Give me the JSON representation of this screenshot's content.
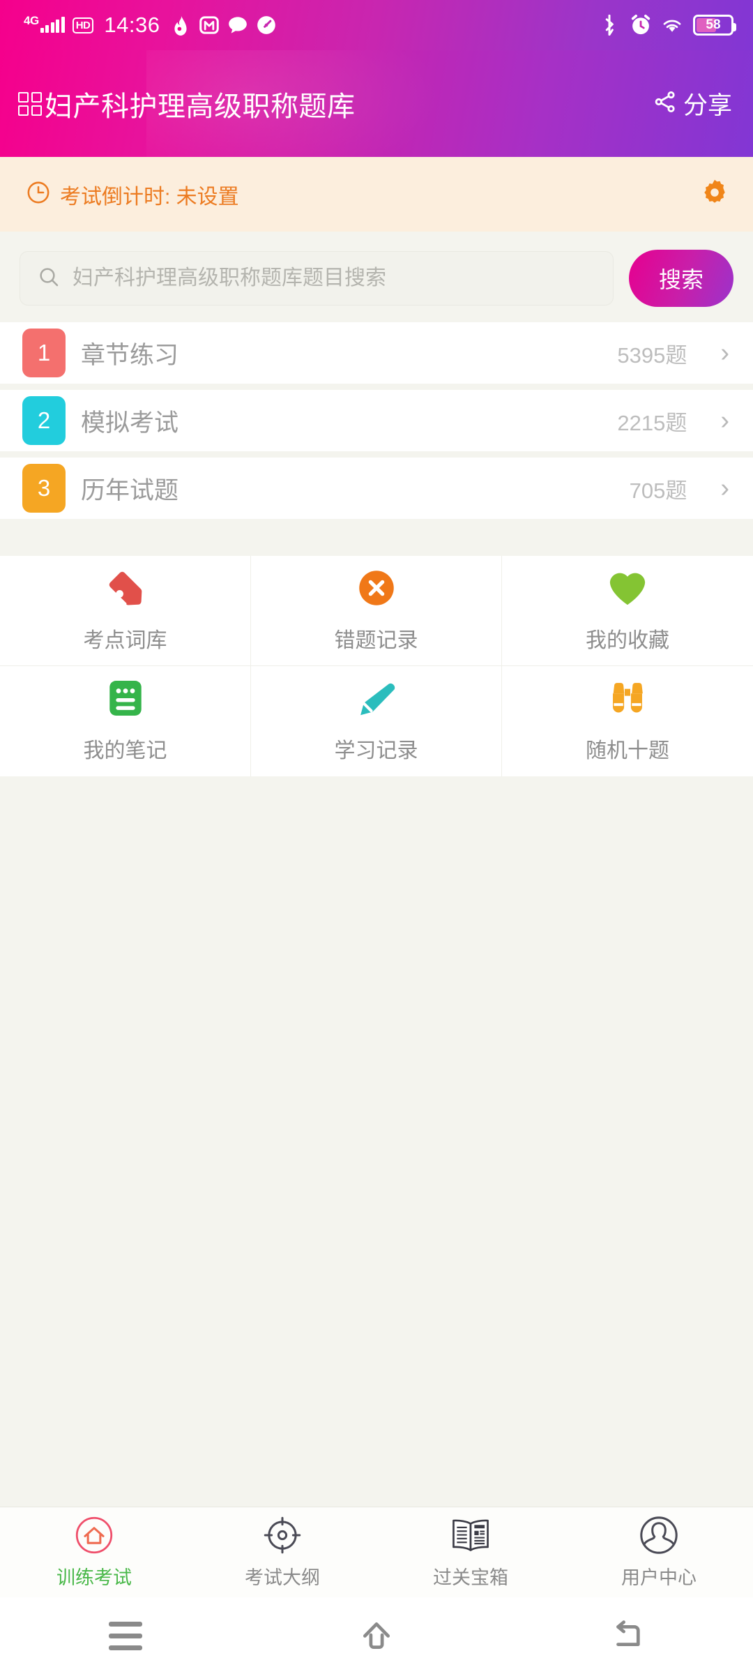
{
  "statusbar": {
    "network_label": "4G",
    "hd_label": "HD",
    "time": "14:36",
    "battery_level": "58",
    "icons": [
      "signal-bars-icon",
      "hd-icon",
      "flame-app-icon",
      "m-app-icon",
      "chat-bubble-icon",
      "speedometer-app-icon",
      "bluetooth-icon",
      "alarm-icon",
      "wifi-icon",
      "battery-icon"
    ]
  },
  "appbar": {
    "title": "妇产科护理高级职称题库",
    "share_label": "分享"
  },
  "countdown": {
    "text": "考试倒计时: 未设置",
    "clock_icon": "clock-icon",
    "settings_icon": "gear-icon",
    "accent_color": "#ec7b21",
    "bg_color": "#fceedd"
  },
  "search": {
    "placeholder": "妇产科护理高级职称题库题目搜索",
    "value": "",
    "button_label": "搜索"
  },
  "rows": [
    {
      "num": "1",
      "label": "章节练习",
      "count": "5395题",
      "color": "#f4706e"
    },
    {
      "num": "2",
      "label": "模拟考试",
      "count": "2215题",
      "color": "#22cddd"
    },
    {
      "num": "3",
      "label": "历年试题",
      "count": "705题",
      "color": "#f5a623"
    }
  ],
  "grid": [
    {
      "label": "考点词库",
      "icon": "tag-icon",
      "color": "#e1504a"
    },
    {
      "label": "错题记录",
      "icon": "close-circle-icon",
      "color": "#f07818"
    },
    {
      "label": "我的收藏",
      "icon": "heart-icon",
      "color": "#84c433"
    },
    {
      "label": "我的笔记",
      "icon": "notes-icon",
      "color": "#35b44a"
    },
    {
      "label": "学习记录",
      "icon": "pencil-icon",
      "color": "#2bbdbd"
    },
    {
      "label": "随机十题",
      "icon": "binoculars-icon",
      "color": "#f5a623"
    }
  ],
  "tabs": [
    {
      "label": "训练考试",
      "icon": "home-circle-icon",
      "active": true
    },
    {
      "label": "考试大纲",
      "icon": "target-icon",
      "active": false
    },
    {
      "label": "过关宝箱",
      "icon": "newspaper-icon",
      "active": false
    },
    {
      "label": "用户中心",
      "icon": "user-circle-icon",
      "active": false
    }
  ],
  "navbar": {
    "menu_icon": "menu-icon",
    "home_icon": "home-icon",
    "back_icon": "back-icon"
  }
}
